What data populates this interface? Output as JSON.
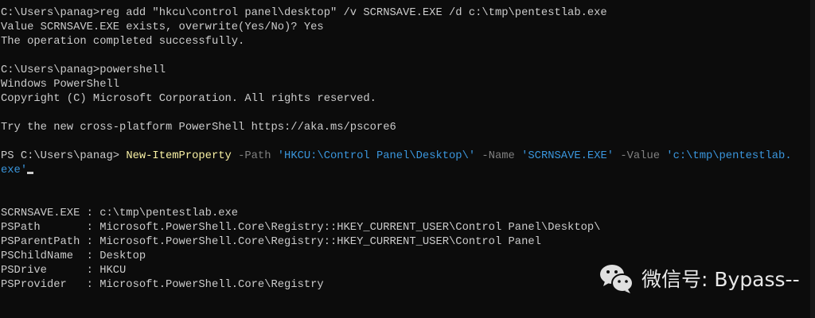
{
  "lines": [
    "C:\\Users\\panag>reg add \"hkcu\\control panel\\desktop\" /v SCRNSAVE.EXE /d c:\\tmp\\pentestlab.exe",
    "Value SCRNSAVE.EXE exists, overwrite(Yes/No)? Yes",
    "The operation completed successfully.",
    "",
    "C:\\Users\\panag>powershell",
    "Windows PowerShell",
    "Copyright (C) Microsoft Corporation. All rights reserved.",
    "",
    "Try the new cross-platform PowerShell https://aka.ms/pscore6",
    ""
  ],
  "ps_command": {
    "prompt": "PS C:\\Users\\panag> ",
    "cmdlet": "New-ItemProperty",
    "p1": " -Path ",
    "v1": "'HKCU:\\Control Panel\\Desktop\\'",
    "p2": " -Name ",
    "v2": "'SCRNSAVE.EXE'",
    "p3": " -Value ",
    "v3a": "'c:\\tmp\\pentestlab.",
    "v3b": "exe'"
  },
  "output": [
    "SCRNSAVE.EXE : c:\\tmp\\pentestlab.exe",
    "PSPath       : Microsoft.PowerShell.Core\\Registry::HKEY_CURRENT_USER\\Control Panel\\Desktop\\",
    "PSParentPath : Microsoft.PowerShell.Core\\Registry::HKEY_CURRENT_USER\\Control Panel",
    "PSChildName  : Desktop",
    "PSDrive      : HKCU",
    "PSProvider   : Microsoft.PowerShell.Core\\Registry"
  ],
  "watermark": "微信号: Bypass--",
  "colors": {
    "bg": "#0c0c0c",
    "fg": "#cccccc",
    "cmdlet": "#f9f1a5",
    "param": "#808080",
    "string": "#3a96dd"
  }
}
